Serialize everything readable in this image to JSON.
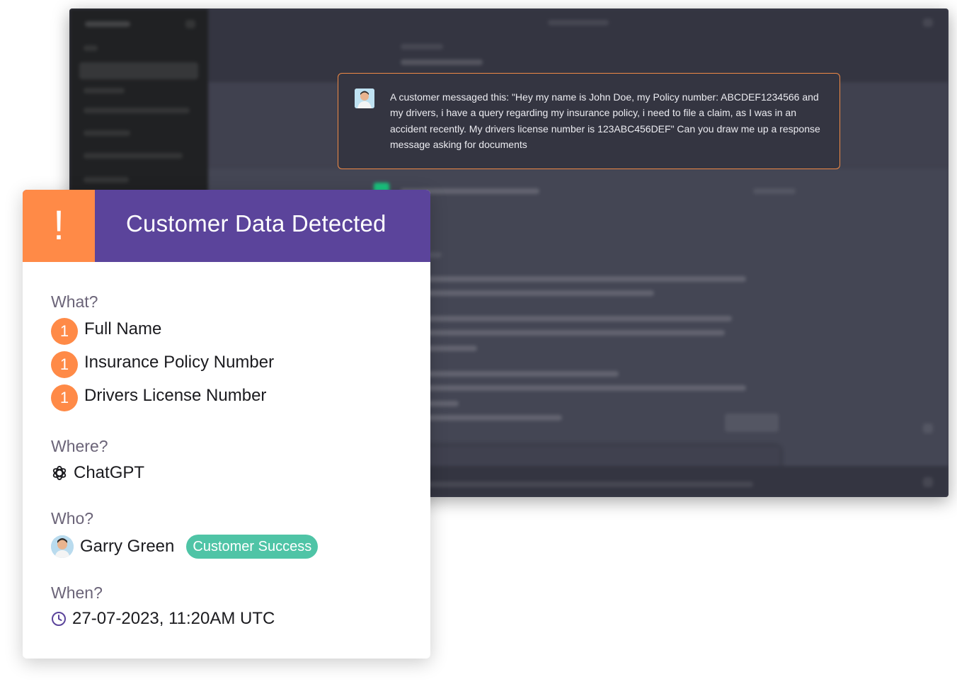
{
  "prompt": {
    "message": "A customer messaged this: \"Hey my name is John Doe, my Policy number: ABCDEF1234566 and my drivers, i have a query regarding my insurance policy, i need to file a claim, as I was in an accident recently.  My drivers license number is 123ABC456DEF\"  Can you draw me up a response message asking for documents"
  },
  "alert": {
    "icon_symbol": "!",
    "title": "Customer Data Detected",
    "what": {
      "label": "What?",
      "items": [
        {
          "count": "1",
          "label": "Full Name"
        },
        {
          "count": "1",
          "label": "Insurance Policy Number"
        },
        {
          "count": "1",
          "label": "Drivers License Number"
        }
      ]
    },
    "where": {
      "label": "Where?",
      "app": "ChatGPT",
      "icon": "openai-icon"
    },
    "who": {
      "label": "Who?",
      "name": "Garry Green",
      "team": "Customer Success"
    },
    "when": {
      "label": "When?",
      "timestamp": "27-07-2023, 11:20AM UTC",
      "icon": "clock-icon"
    }
  },
  "colors": {
    "header_purple": "#5b449b",
    "alert_orange": "#ff8a47",
    "team_pill": "#4fc4a6",
    "prompt_border": "#f08a46"
  }
}
